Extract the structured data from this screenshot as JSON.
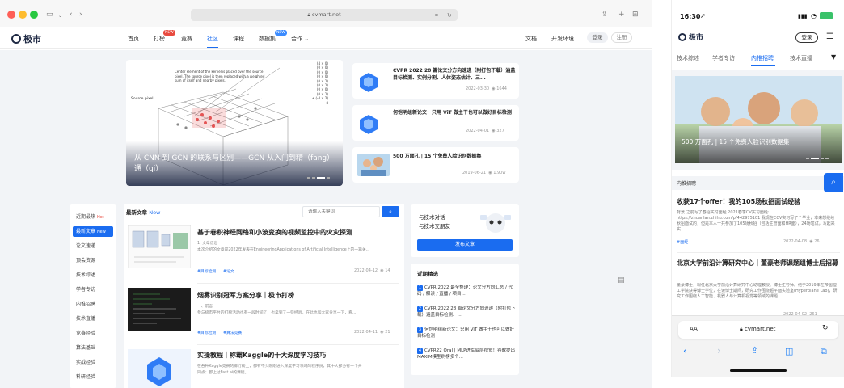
{
  "browser": {
    "url": "cvmart.net",
    "mobile_url": "cvmart.net",
    "mobile_aa": "AA"
  },
  "nav": {
    "logo": "极市",
    "items": [
      "首页",
      "打榜",
      "竞赛",
      "社区",
      "课程",
      "数据集",
      "合作"
    ],
    "badges": [
      "NEW",
      "NEW"
    ],
    "right": [
      "文档",
      "开发环境"
    ],
    "login": "登录",
    "register": "注册"
  },
  "hero": {
    "title": "从 CNN 到 GCN 的联系与区别——GCN 从入门到精（fang）通（qi）",
    "caption": "Center element of the kernel is placed over the source pixel. The source pixel is then replaced with a weighted sum of itself and nearby pixels.",
    "source_label": "Source pixel",
    "calc": [
      "(4 × 0)",
      "(0 × 0)",
      "(0 × 0)",
      "(0 × 0)",
      "(0 × 1)",
      "(0 × 1)",
      "(0 × 0)",
      "(0 × 1)",
      "+ (-4 × 2)",
      "-8"
    ]
  },
  "cards": [
    {
      "title": "CVPR 2022 28 篇论文分方向速递（附打包下载）涵盖目标检测、实例分割、人体姿态估计、三...",
      "date": "2022-03-30",
      "views": "1644"
    },
    {
      "title": "何恺明组新论文：只用 ViT 做主干也可以做好目标检测",
      "date": "2022-04-01",
      "views": "327"
    },
    {
      "title": "500 万面孔 | 15 个免费人脸识别数据集",
      "date": "2019-06-21",
      "views": "1.90w"
    }
  ],
  "side": {
    "items": [
      "近期最热",
      "最新文章",
      "论文速递",
      "顶会资源",
      "技术综述",
      "学者专访",
      "内推招聘",
      "技术直播",
      "竞赛经验",
      "算法基础",
      "实战经验",
      "科研经验"
    ],
    "hot": "Hot",
    "new": "New"
  },
  "list": {
    "heading": "最新文章",
    "new": "New",
    "search_placeholder": "请输入关键词",
    "articles": [
      {
        "title": "基于卷积神经网络和小波变换的视频监控中的火灾探测",
        "desc_a": "1. 文章信息",
        "desc_b": "本次介绍的文章是2022年发表在EngineeringApplications of Artificial Intelligence上的一篇关...",
        "tags": [
          "#目标检测",
          "#论文"
        ],
        "date": "2022-04-12",
        "views": "14"
      },
      {
        "title": "烟雾识别冠军方案分享｜极市打榜",
        "desc_a": "一、前言",
        "desc_b": "参与极市平台的打榜活动也有一段时间了，也拿到了一些经验。在此也和大家分享一下，看...",
        "tags": [
          "#目标检测",
          "#算法竞赛"
        ],
        "date": "2022-04-11",
        "views": "21"
      },
      {
        "title": "实操教程｜称霸Kaggle的十大深度学习技巧",
        "desc_a": "在各种Kaggle竞赛的排行榜上，都有不少刚刚进入深度学习领域的程序员，其中大部分有一个共",
        "desc_b": "同点：都上过Fast.ai的课程。..."
      }
    ]
  },
  "promo": {
    "line1": "与技术对话",
    "line2": "与技术交朋友",
    "button": "发布文章"
  },
  "recent": {
    "heading": "近期精选",
    "items": [
      {
        "n": "1",
        "text": "CVPR 2022 最全整理：论文分方向汇总 / 代码 / 解读 / 直播 / 项目..."
      },
      {
        "n": "2",
        "text": "CVPR 2022 28 篇论文分方向速递（附打包下载）涵盖目标检测、..."
      },
      {
        "n": "3",
        "text": "何恺明组新论文：只用 ViT 做主干也可以做好目标检测"
      },
      {
        "n": "4",
        "text": "CVPR22 Oral | MLP进军底层视觉！谷歌提出MAXIM模型刷榜多个..."
      }
    ]
  },
  "mobile": {
    "time": "16:30",
    "logo": "极市",
    "login": "登录",
    "tabs": [
      "技术综述",
      "学者专访",
      "内推招聘",
      "技术直播"
    ],
    "hero_title": "500 万面孔 | 15 个免费人脸识别数据集",
    "section": "内推招聘",
    "posts": [
      {
        "title": "收获17个offer！我的105场秋招面试经验",
        "desc": "背景 之前写了春招实习面经 2021春季CV实习面经: https://zhuanlan.zhihu.com/p/442975101 我现在CCV实习写了个毕业，本来想继续秋招面试的，但是本人一共参加了105场秋招（包括主管面和HR面），24场笔试，写起来实...",
        "tag": "#面经",
        "date": "2022-04-08",
        "views": "26"
      },
      {
        "title": "北京大学前沿计算研究中心｜董豪老师课题组博士后招募",
        "desc": "董豪博士，现任北京大学前沿计算研究中心助理教授、博士生导师。他于2019年在帝国理工学院获得博士学位，在读博士期间，研究工作围绕超平面实验室(Hyperplane Lab)，研究工作围绕人工智能、机器人与计算机视觉等领域的课题...",
        "date": "2022-04-02",
        "views": "261"
      }
    ]
  },
  "colors": {
    "accent": "#1a6cf0",
    "hot": "#e84a3f",
    "bg": "#f2f4f7"
  }
}
